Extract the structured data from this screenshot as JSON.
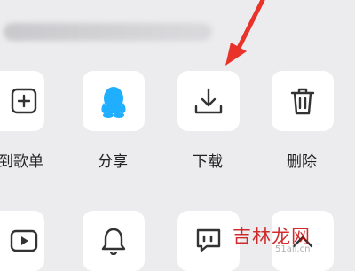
{
  "actions_row1": [
    {
      "label": "到歌单",
      "icon": "add-square-icon"
    },
    {
      "label": "分享",
      "icon": "qq-penguin-icon"
    },
    {
      "label": "下载",
      "icon": "download-icon"
    },
    {
      "label": "删除",
      "icon": "trash-icon"
    }
  ],
  "actions_row2": [
    {
      "icon": "play-icon"
    },
    {
      "icon": "bell-icon"
    },
    {
      "icon": "quote-icon"
    },
    {
      "icon": "up-chevron-icon"
    }
  ],
  "watermark": {
    "text": "吉林龙网",
    "sub": "51ali.cn"
  },
  "colors": {
    "accent": "#20aeff",
    "arrow": "#e8322a",
    "icon": "#333333",
    "tile": "#ffffff"
  }
}
